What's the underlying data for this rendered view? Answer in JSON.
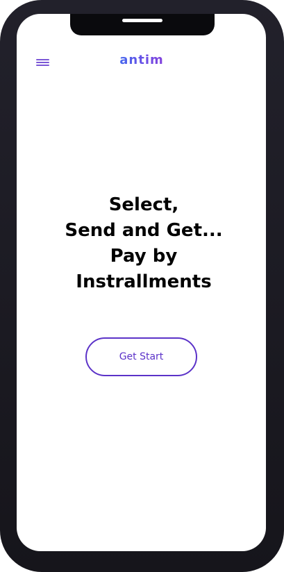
{
  "app": {
    "logo_text": "antim",
    "logo_gradient": [
      "#3f6ff0",
      "#8b3fd9"
    ]
  },
  "header": {
    "menu_icon": "hamburger-menu-icon"
  },
  "hero": {
    "lines": [
      "Select,",
      "Send and Get...",
      "Pay by",
      "Instrallments"
    ]
  },
  "cta": {
    "label": "Get Start",
    "color": "#5b32c8"
  },
  "theme": {
    "accent": "#7b57d6",
    "frame": "#1b1a21",
    "background": "#ffffff"
  }
}
